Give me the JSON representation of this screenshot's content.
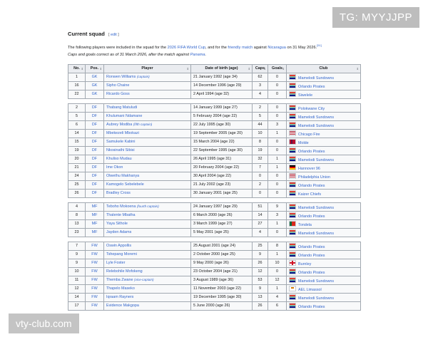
{
  "overlay": {
    "top_right": "TG: MYYJJPP",
    "bottom_left": "vty-club.com"
  },
  "section": {
    "heading": "Current squad",
    "edit_open": "[ ",
    "edit_label": "edit",
    "edit_close": " ]"
  },
  "intro": {
    "p1": "The following players were included in the squad for the ",
    "link1": "2026 FIFA World Cup",
    "p2": ", and for the ",
    "link2": "friendly match",
    "p3": " against ",
    "link3": "Nicaragua",
    "p4": " on 31 May 2026.",
    "ref": "[51]",
    "caption1": "Caps and goals correct as of 31 March 2026, after the match against ",
    "caption_link": "Panama",
    "caption2": "."
  },
  "table": {
    "headers": [
      "No.",
      "Pos.",
      "Player",
      "Date of birth (age)",
      "Caps",
      "Goals",
      "Club"
    ],
    "groups": [
      [
        {
          "no": "1",
          "pos": "GK",
          "player": "Ronwen Williams",
          "note": "(captain)",
          "dob": "21 January 1992 (age 34)",
          "caps": "62",
          "goals": "0",
          "club": "Mamelodi Sundowns",
          "flag": "za"
        },
        {
          "no": "16",
          "pos": "GK",
          "player": "Sipho Chaine",
          "note": "",
          "dob": "14 December 1996 (age 29)",
          "caps": "3",
          "goals": "0",
          "club": "Orlando Pirates",
          "flag": "za"
        },
        {
          "no": "22",
          "pos": "GK",
          "player": "Ricardo Goss",
          "note": "",
          "dob": "2 April 1994 (age 32)",
          "caps": "4",
          "goals": "0",
          "club": "Siwelele",
          "flag": "za"
        }
      ],
      [
        {
          "no": "2",
          "pos": "DF",
          "player": "Thabang Matuludi",
          "note": "",
          "dob": "14 January 1999 (age 27)",
          "caps": "2",
          "goals": "0",
          "club": "Polokwane City",
          "flag": "za"
        },
        {
          "no": "5",
          "pos": "DF",
          "player": "Khulumani Ndamane",
          "note": "",
          "dob": "5 February 2004 (age 22)",
          "caps": "5",
          "goals": "0",
          "club": "Mamelodi Sundowns",
          "flag": "za"
        },
        {
          "no": "6",
          "pos": "DF",
          "player": "Aubrey Modiba",
          "note": "(fifth captain)",
          "dob": "22 July 1995 (age 30)",
          "caps": "44",
          "goals": "3",
          "club": "Mamelodi Sundowns",
          "flag": "za"
        },
        {
          "no": "14",
          "pos": "DF",
          "player": "Mbekezeli Mbokazi",
          "note": "",
          "dob": "19 September 2005 (age 20)",
          "caps": "10",
          "goals": "1",
          "club": "Chicago Fire",
          "flag": "us"
        },
        {
          "no": "15",
          "pos": "DF",
          "player": "Samukele Kabini",
          "note": "",
          "dob": "15 March 2004 (age 22)",
          "caps": "8",
          "goals": "0",
          "club": "Molde",
          "flag": "no"
        },
        {
          "no": "19",
          "pos": "DF",
          "player": "Nkosinathi Sibisi",
          "note": "",
          "dob": "22 September 1995 (age 30)",
          "caps": "19",
          "goals": "0",
          "club": "Orlando Pirates",
          "flag": "za"
        },
        {
          "no": "20",
          "pos": "DF",
          "player": "Khuliso Mudau",
          "note": "",
          "dob": "26 April 1995 (age 31)",
          "caps": "32",
          "goals": "1",
          "club": "Mamelodi Sundowns",
          "flag": "za"
        },
        {
          "no": "21",
          "pos": "DF",
          "player": "Ime Okon",
          "note": "",
          "dob": "20 February 2004 (age 22)",
          "caps": "7",
          "goals": "1",
          "club": "Hannover 96",
          "flag": "de"
        },
        {
          "no": "24",
          "pos": "DF",
          "player": "Olwethu Makhanya",
          "note": "",
          "dob": "30 April 2004 (age 22)",
          "caps": "0",
          "goals": "0",
          "club": "Philadelphia Union",
          "flag": "us"
        },
        {
          "no": "25",
          "pos": "DF",
          "player": "Kamogelo Sebelebele",
          "note": "",
          "dob": "21 July 2002 (age 23)",
          "caps": "2",
          "goals": "0",
          "club": "Orlando Pirates",
          "flag": "za"
        },
        {
          "no": "26",
          "pos": "DF",
          "player": "Bradley Cross",
          "note": "",
          "dob": "30 January 2001 (age 25)",
          "caps": "0",
          "goals": "0",
          "club": "Kaizer Chiefs",
          "flag": "za"
        }
      ],
      [
        {
          "no": "4",
          "pos": "MF",
          "player": "Teboho Mokoena",
          "note": "(fourth captain)",
          "dob": "24 January 1997 (age 29)",
          "caps": "51",
          "goals": "9",
          "club": "Mamelodi Sundowns",
          "flag": "za"
        },
        {
          "no": "8",
          "pos": "MF",
          "player": "Thalente Mbatha",
          "note": "",
          "dob": "6 March 2000 (age 26)",
          "caps": "14",
          "goals": "3",
          "club": "Orlando Pirates",
          "flag": "za"
        },
        {
          "no": "13",
          "pos": "MF",
          "player": "Yaya Sithole",
          "note": "",
          "dob": "3 March 1999 (age 27)",
          "caps": "27",
          "goals": "1",
          "club": "Tondela",
          "flag": "pt"
        },
        {
          "no": "23",
          "pos": "MF",
          "player": "Jayden Adams",
          "note": "",
          "dob": "5 May 2001 (age 25)",
          "caps": "4",
          "goals": "0",
          "club": "Mamelodi Sundowns",
          "flag": "za"
        }
      ],
      [
        {
          "no": "7",
          "pos": "FW",
          "player": "Oswin Appollis",
          "note": "",
          "dob": "25 August 2001 (age 24)",
          "caps": "25",
          "goals": "8",
          "club": "Orlando Pirates",
          "flag": "za"
        },
        {
          "no": "9",
          "pos": "FW",
          "player": "Tshepang Moremi",
          "note": "",
          "dob": "2 October 2000 (age 25)",
          "caps": "9",
          "goals": "1",
          "club": "Orlando Pirates",
          "flag": "za"
        },
        {
          "no": "9",
          "pos": "FW",
          "player": "Lyle Foster",
          "note": "",
          "dob": "9 May 2000 (age 26)",
          "caps": "26",
          "goals": "10",
          "club": "Burnley",
          "flag": "en"
        },
        {
          "no": "10",
          "pos": "FW",
          "player": "Relebohile Mofokeng",
          "note": "",
          "dob": "23 October 2004 (age 21)",
          "caps": "12",
          "goals": "0",
          "club": "Orlando Pirates",
          "flag": "za"
        },
        {
          "no": "11",
          "pos": "FW",
          "player": "Themba Zwane",
          "note": "(vice-captain)",
          "dob": "3 August 1989 (age 36)",
          "caps": "53",
          "goals": "12",
          "club": "Mamelodi Sundowns",
          "flag": "za"
        },
        {
          "no": "12",
          "pos": "FW",
          "player": "Thapelo Maseko",
          "note": "",
          "dob": "11 November 2003 (age 22)",
          "caps": "9",
          "goals": "1",
          "club": "AEL Limassol",
          "flag": "cy"
        },
        {
          "no": "14",
          "pos": "FW",
          "player": "Iqraam Rayners",
          "note": "",
          "dob": "19 December 1995 (age 30)",
          "caps": "13",
          "goals": "4",
          "club": "Mamelodi Sundowns",
          "flag": "za"
        },
        {
          "no": "17",
          "pos": "FW",
          "player": "Evidence Makgopa",
          "note": "",
          "dob": "5 June 2000 (age 26)",
          "caps": "26",
          "goals": "6",
          "club": "Orlando Pirates",
          "flag": "za"
        }
      ]
    ]
  }
}
